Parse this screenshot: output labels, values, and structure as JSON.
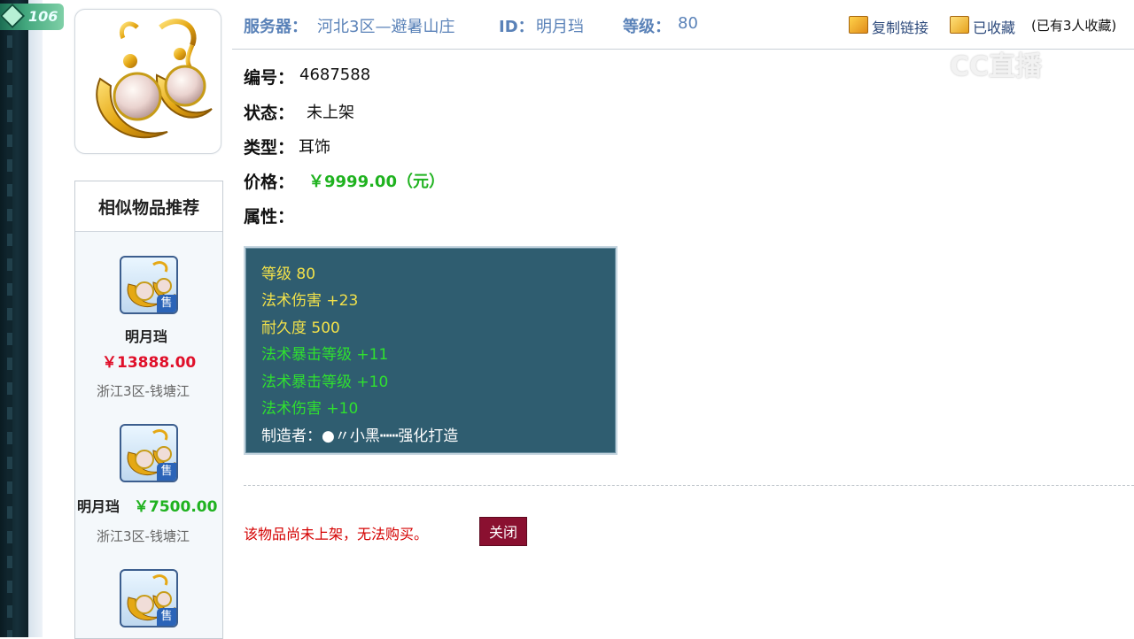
{
  "badge": {
    "level_text": "106"
  },
  "header": {
    "server_label": "服务器：",
    "server_value": "河北3区—避暑山庄",
    "id_label": "ID：",
    "id_value": "明月珰",
    "level_label": "等级：",
    "level_value": "80",
    "copy_link": "复制链接",
    "favorited": "已收藏",
    "fav_count": "(已有3人收藏)"
  },
  "info": {
    "number_label": "编号：",
    "number_value": "4687588",
    "status_label": "状态：",
    "status_value": "未上架",
    "type_label": "类型：",
    "type_value": "耳饰",
    "price_label": "价格：",
    "price_value": "￥9999.00（元）",
    "attr_label": "属性："
  },
  "attributes": [
    {
      "text": "等级 80",
      "color": "#f2e14a"
    },
    {
      "text": "法术伤害 +23",
      "color": "#f2e14a"
    },
    {
      "text": "耐久度 500",
      "color": "#f2e14a"
    },
    {
      "text": "法术暴击等级 +11",
      "color": "#2fe02f"
    },
    {
      "text": "法术暴击等级 +10",
      "color": "#2fe02f"
    },
    {
      "text": "法术伤害 +10",
      "color": "#2fe02f"
    },
    {
      "text": "制造者：●〃小黑┅┅强化打造",
      "color": "#ffffff"
    }
  ],
  "similar": {
    "title": "相似物品推荐",
    "sale_tag": "售",
    "items": [
      {
        "name": "明月珰",
        "price": "￥13888.00",
        "price_color": "#e0102a",
        "server": "浙江3区-钱塘江"
      },
      {
        "name": "明月珰",
        "price": "￥7500.00",
        "price_color": "#1fb21f",
        "server": "浙江3区-钱塘江"
      },
      {
        "name": "",
        "price": "",
        "price_color": "#1fb21f",
        "server": ""
      }
    ]
  },
  "footer": {
    "notice": "该物品尚未上架，无法购买。",
    "close_label": "关闭"
  },
  "overlay": {
    "stream_logo": "CC直播"
  },
  "colors": {
    "header_text": "#5a82b8",
    "price_green": "#1fb21f",
    "attr_bg": "#2f5d70",
    "close_bg": "#8a1030"
  }
}
